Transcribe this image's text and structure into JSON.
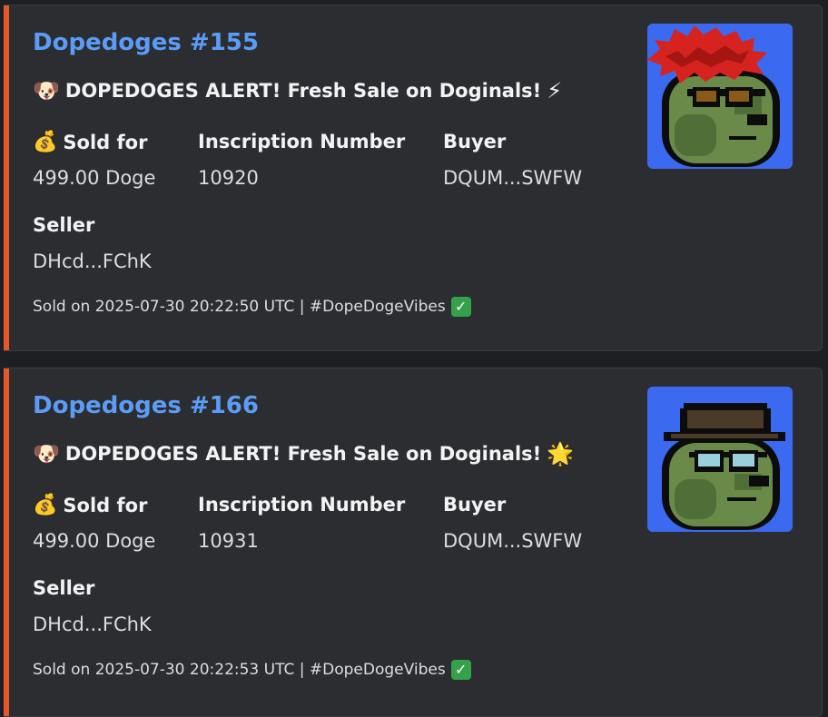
{
  "accent_color": "#e8572a",
  "title_color": "#5b9cf6",
  "embeds": [
    {
      "title": "Dopedoges #155",
      "alert_emoji": "🐶",
      "alert": "DOPEDOGES ALERT! Fresh Sale on Doginals!",
      "alert_end_emoji": "⚡",
      "sold_for_emoji": "💰",
      "sold_for_label": "Sold for",
      "sold_for_value": "499.00 Doge",
      "inscription_label": "Inscription Number",
      "inscription_value": "10920",
      "buyer_label": "Buyer",
      "buyer_value": "DQUM...SWFW",
      "seller_label": "Seller",
      "seller_value": "DHcd...FChK",
      "footer": "Sold on 2025-07-30 20:22:50 UTC | #DopeDogeVibes",
      "footer_check": "✓",
      "thumbnail_icon": "dopedoge-red-hair-sunglasses"
    },
    {
      "title": "Dopedoges #166",
      "alert_emoji": "🐶",
      "alert": "DOPEDOGES ALERT! Fresh Sale on Doginals!",
      "alert_end_emoji": "🌟",
      "sold_for_emoji": "💰",
      "sold_for_label": "Sold for",
      "sold_for_value": "499.00 Doge",
      "inscription_label": "Inscription Number",
      "inscription_value": "10931",
      "buyer_label": "Buyer",
      "buyer_value": "DQUM...SWFW",
      "seller_label": "Seller",
      "seller_value": "DHcd...FChK",
      "footer": "Sold on 2025-07-30 20:22:53 UTC | #DopeDogeVibes",
      "footer_check": "✓",
      "thumbnail_icon": "dopedoge-fedora-glasses"
    }
  ]
}
